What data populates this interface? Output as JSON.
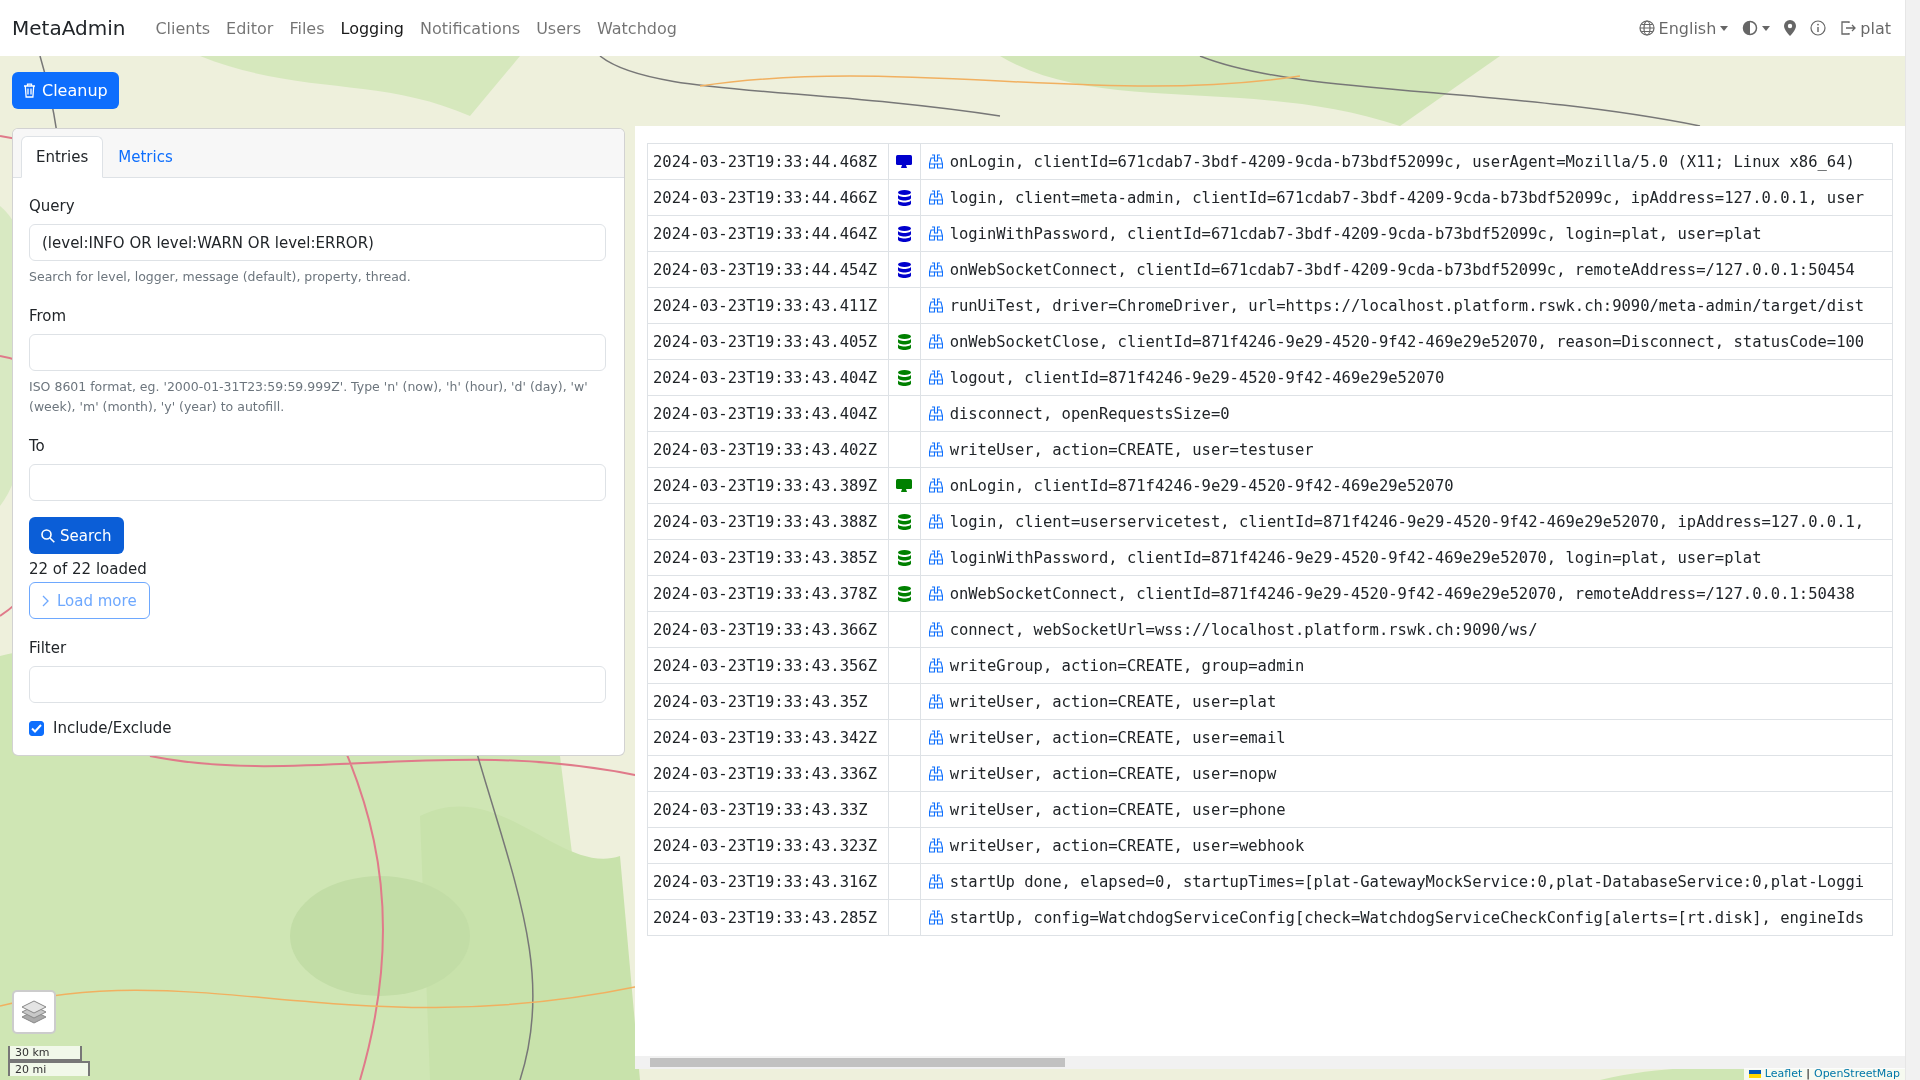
{
  "navbar": {
    "brand": "MetaAdmin",
    "links": [
      {
        "label": "Clients",
        "selected": false
      },
      {
        "label": "Editor",
        "selected": false
      },
      {
        "label": "Files",
        "selected": false
      },
      {
        "label": "Logging",
        "selected": true
      },
      {
        "label": "Notifications",
        "selected": false
      },
      {
        "label": "Users",
        "selected": false
      },
      {
        "label": "Watchdog",
        "selected": false
      }
    ],
    "language": "English",
    "user": "plat"
  },
  "cleanup_button": "Cleanup",
  "tabs": [
    {
      "label": "Entries",
      "selected": true
    },
    {
      "label": "Metrics",
      "selected": false
    }
  ],
  "query": {
    "label": "Query",
    "value": "(level:INFO OR level:WARN OR level:ERROR)",
    "help": "Search for level, logger, message (default), property, thread."
  },
  "from": {
    "label": "From",
    "help": "ISO 8601 format, eg. '2000-01-31T23:59:59.999Z'. Type 'n' (now), 'h' (hour), 'd' (day), 'w' (week), 'm' (month), 'y' (year) to autofill."
  },
  "to": {
    "label": "To"
  },
  "search_button": "Search",
  "loaded_count": "22 of 22 loaded",
  "load_more_button": "Load more",
  "filter": {
    "label": "Filter"
  },
  "include_exclude": {
    "label": "Include/Exclude",
    "checked": true
  },
  "map": {
    "kind": "picture",
    "scale": [
      "30 km",
      "20 mi"
    ],
    "attribution": {
      "links": [
        "Leaflet",
        "OpenStreetMap"
      ],
      "separator": "|"
    }
  },
  "log_entries": [
    {
      "time": "2024-03-23T19:33:44.468Z",
      "kind": "monitor",
      "color": "#0000cd",
      "message": "onLogin, clientId=671cdab7-3bdf-4209-9cda-b73bdf52099c, userAgent=Mozilla/5.0 (X11; Linux x86_64)"
    },
    {
      "time": "2024-03-23T19:33:44.466Z",
      "kind": "database",
      "color": "#0000cd",
      "message": "login, client=meta-admin, clientId=671cdab7-3bdf-4209-9cda-b73bdf52099c, ipAddress=127.0.0.1, user"
    },
    {
      "time": "2024-03-23T19:33:44.464Z",
      "kind": "database",
      "color": "#0000cd",
      "message": "loginWithPassword, clientId=671cdab7-3bdf-4209-9cda-b73bdf52099c, login=plat, user=plat"
    },
    {
      "time": "2024-03-23T19:33:44.454Z",
      "kind": "database",
      "color": "#0000cd",
      "message": "onWebSocketConnect, clientId=671cdab7-3bdf-4209-9cda-b73bdf52099c, remoteAddress=/127.0.0.1:50454"
    },
    {
      "time": "2024-03-23T19:33:43.411Z",
      "kind": "none",
      "message": "runUiTest, driver=ChromeDriver, url=https://localhost.platform.rswk.ch:9090/meta-admin/target/dist"
    },
    {
      "time": "2024-03-23T19:33:43.405Z",
      "kind": "database",
      "color": "#008000",
      "message": "onWebSocketClose, clientId=871f4246-9e29-4520-9f42-469e29e52070, reason=Disconnect, statusCode=100"
    },
    {
      "time": "2024-03-23T19:33:43.404Z",
      "kind": "database",
      "color": "#008000",
      "message": "logout, clientId=871f4246-9e29-4520-9f42-469e29e52070"
    },
    {
      "time": "2024-03-23T19:33:43.404Z",
      "kind": "none",
      "message": "disconnect, openRequestsSize=0"
    },
    {
      "time": "2024-03-23T19:33:43.402Z",
      "kind": "none",
      "message": "writeUser, action=CREATE, user=testuser"
    },
    {
      "time": "2024-03-23T19:33:43.389Z",
      "kind": "monitor",
      "color": "#008000",
      "message": "onLogin, clientId=871f4246-9e29-4520-9f42-469e29e52070"
    },
    {
      "time": "2024-03-23T19:33:43.388Z",
      "kind": "database",
      "color": "#008000",
      "message": "login, client=userservicetest, clientId=871f4246-9e29-4520-9f42-469e29e52070, ipAddress=127.0.0.1,"
    },
    {
      "time": "2024-03-23T19:33:43.385Z",
      "kind": "database",
      "color": "#008000",
      "message": "loginWithPassword, clientId=871f4246-9e29-4520-9f42-469e29e52070, login=plat, user=plat"
    },
    {
      "time": "2024-03-23T19:33:43.378Z",
      "kind": "database",
      "color": "#008000",
      "message": "onWebSocketConnect, clientId=871f4246-9e29-4520-9f42-469e29e52070, remoteAddress=/127.0.0.1:50438"
    },
    {
      "time": "2024-03-23T19:33:43.366Z",
      "kind": "none",
      "message": "connect, webSocketUrl=wss://localhost.platform.rswk.ch:9090/ws/"
    },
    {
      "time": "2024-03-23T19:33:43.356Z",
      "kind": "none",
      "message": "writeGroup, action=CREATE, group=admin"
    },
    {
      "time": "2024-03-23T19:33:43.35Z",
      "kind": "none",
      "message": "writeUser, action=CREATE, user=plat"
    },
    {
      "time": "2024-03-23T19:33:43.342Z",
      "kind": "none",
      "message": "writeUser, action=CREATE, user=email"
    },
    {
      "time": "2024-03-23T19:33:43.336Z",
      "kind": "none",
      "message": "writeUser, action=CREATE, user=nopw"
    },
    {
      "time": "2024-03-23T19:33:43.33Z",
      "kind": "none",
      "message": "writeUser, action=CREATE, user=phone"
    },
    {
      "time": "2024-03-23T19:33:43.323Z",
      "kind": "none",
      "message": "writeUser, action=CREATE, user=webhook"
    },
    {
      "time": "2024-03-23T19:33:43.316Z",
      "kind": "none",
      "message": "startUp done, elapsed=0, startupTimes=[plat-GatewayMockService:0,plat-DatabaseService:0,plat-Loggi"
    },
    {
      "time": "2024-03-23T19:33:43.285Z",
      "kind": "none",
      "message": "startUp, config=WatchdogServiceConfig[check=WatchdogServiceCheckConfig[alerts=[rt.disk], engineIds"
    }
  ]
}
